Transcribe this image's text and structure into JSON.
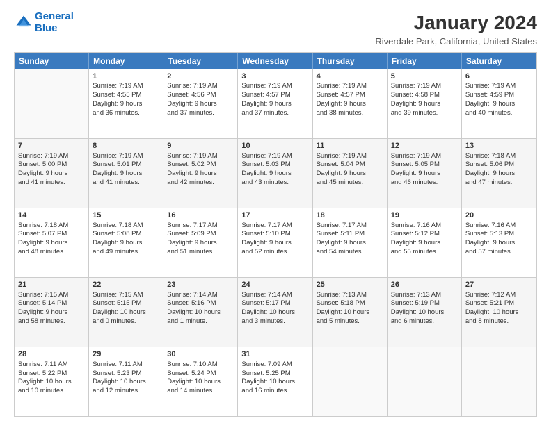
{
  "header": {
    "logo_line1": "General",
    "logo_line2": "Blue",
    "main_title": "January 2024",
    "subtitle": "Riverdale Park, California, United States"
  },
  "calendar": {
    "days": [
      "Sunday",
      "Monday",
      "Tuesday",
      "Wednesday",
      "Thursday",
      "Friday",
      "Saturday"
    ],
    "rows": [
      [
        {
          "num": "",
          "text": ""
        },
        {
          "num": "1",
          "text": "Sunrise: 7:19 AM\nSunset: 4:55 PM\nDaylight: 9 hours\nand 36 minutes."
        },
        {
          "num": "2",
          "text": "Sunrise: 7:19 AM\nSunset: 4:56 PM\nDaylight: 9 hours\nand 37 minutes."
        },
        {
          "num": "3",
          "text": "Sunrise: 7:19 AM\nSunset: 4:57 PM\nDaylight: 9 hours\nand 37 minutes."
        },
        {
          "num": "4",
          "text": "Sunrise: 7:19 AM\nSunset: 4:57 PM\nDaylight: 9 hours\nand 38 minutes."
        },
        {
          "num": "5",
          "text": "Sunrise: 7:19 AM\nSunset: 4:58 PM\nDaylight: 9 hours\nand 39 minutes."
        },
        {
          "num": "6",
          "text": "Sunrise: 7:19 AM\nSunset: 4:59 PM\nDaylight: 9 hours\nand 40 minutes."
        }
      ],
      [
        {
          "num": "7",
          "text": "Sunrise: 7:19 AM\nSunset: 5:00 PM\nDaylight: 9 hours\nand 41 minutes."
        },
        {
          "num": "8",
          "text": "Sunrise: 7:19 AM\nSunset: 5:01 PM\nDaylight: 9 hours\nand 41 minutes."
        },
        {
          "num": "9",
          "text": "Sunrise: 7:19 AM\nSunset: 5:02 PM\nDaylight: 9 hours\nand 42 minutes."
        },
        {
          "num": "10",
          "text": "Sunrise: 7:19 AM\nSunset: 5:03 PM\nDaylight: 9 hours\nand 43 minutes."
        },
        {
          "num": "11",
          "text": "Sunrise: 7:19 AM\nSunset: 5:04 PM\nDaylight: 9 hours\nand 45 minutes."
        },
        {
          "num": "12",
          "text": "Sunrise: 7:19 AM\nSunset: 5:05 PM\nDaylight: 9 hours\nand 46 minutes."
        },
        {
          "num": "13",
          "text": "Sunrise: 7:18 AM\nSunset: 5:06 PM\nDaylight: 9 hours\nand 47 minutes."
        }
      ],
      [
        {
          "num": "14",
          "text": "Sunrise: 7:18 AM\nSunset: 5:07 PM\nDaylight: 9 hours\nand 48 minutes."
        },
        {
          "num": "15",
          "text": "Sunrise: 7:18 AM\nSunset: 5:08 PM\nDaylight: 9 hours\nand 49 minutes."
        },
        {
          "num": "16",
          "text": "Sunrise: 7:17 AM\nSunset: 5:09 PM\nDaylight: 9 hours\nand 51 minutes."
        },
        {
          "num": "17",
          "text": "Sunrise: 7:17 AM\nSunset: 5:10 PM\nDaylight: 9 hours\nand 52 minutes."
        },
        {
          "num": "18",
          "text": "Sunrise: 7:17 AM\nSunset: 5:11 PM\nDaylight: 9 hours\nand 54 minutes."
        },
        {
          "num": "19",
          "text": "Sunrise: 7:16 AM\nSunset: 5:12 PM\nDaylight: 9 hours\nand 55 minutes."
        },
        {
          "num": "20",
          "text": "Sunrise: 7:16 AM\nSunset: 5:13 PM\nDaylight: 9 hours\nand 57 minutes."
        }
      ],
      [
        {
          "num": "21",
          "text": "Sunrise: 7:15 AM\nSunset: 5:14 PM\nDaylight: 9 hours\nand 58 minutes."
        },
        {
          "num": "22",
          "text": "Sunrise: 7:15 AM\nSunset: 5:15 PM\nDaylight: 10 hours\nand 0 minutes."
        },
        {
          "num": "23",
          "text": "Sunrise: 7:14 AM\nSunset: 5:16 PM\nDaylight: 10 hours\nand 1 minute."
        },
        {
          "num": "24",
          "text": "Sunrise: 7:14 AM\nSunset: 5:17 PM\nDaylight: 10 hours\nand 3 minutes."
        },
        {
          "num": "25",
          "text": "Sunrise: 7:13 AM\nSunset: 5:18 PM\nDaylight: 10 hours\nand 5 minutes."
        },
        {
          "num": "26",
          "text": "Sunrise: 7:13 AM\nSunset: 5:19 PM\nDaylight: 10 hours\nand 6 minutes."
        },
        {
          "num": "27",
          "text": "Sunrise: 7:12 AM\nSunset: 5:21 PM\nDaylight: 10 hours\nand 8 minutes."
        }
      ],
      [
        {
          "num": "28",
          "text": "Sunrise: 7:11 AM\nSunset: 5:22 PM\nDaylight: 10 hours\nand 10 minutes."
        },
        {
          "num": "29",
          "text": "Sunrise: 7:11 AM\nSunset: 5:23 PM\nDaylight: 10 hours\nand 12 minutes."
        },
        {
          "num": "30",
          "text": "Sunrise: 7:10 AM\nSunset: 5:24 PM\nDaylight: 10 hours\nand 14 minutes."
        },
        {
          "num": "31",
          "text": "Sunrise: 7:09 AM\nSunset: 5:25 PM\nDaylight: 10 hours\nand 16 minutes."
        },
        {
          "num": "",
          "text": ""
        },
        {
          "num": "",
          "text": ""
        },
        {
          "num": "",
          "text": ""
        }
      ]
    ]
  }
}
